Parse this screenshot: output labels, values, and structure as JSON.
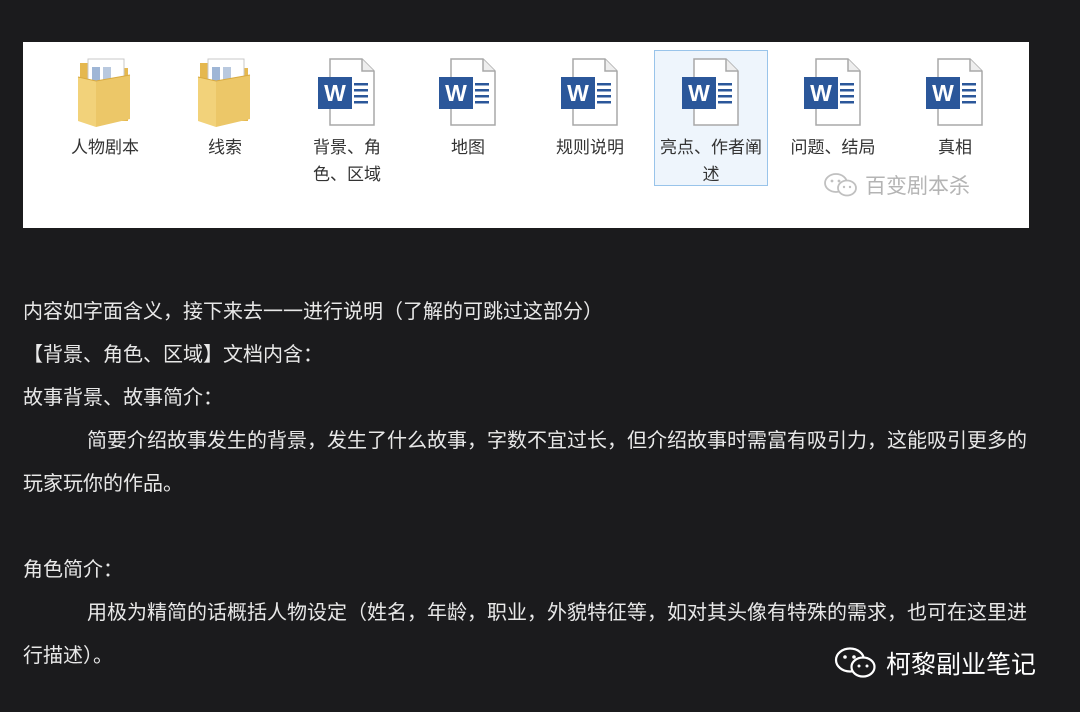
{
  "explorer": {
    "items": [
      {
        "label": "人物剧本",
        "icon": "folder-icon"
      },
      {
        "label": "线索",
        "icon": "folder-icon"
      },
      {
        "label": "背景、角色、区域",
        "icon": "word-document-icon"
      },
      {
        "label": "地图",
        "icon": "word-document-icon"
      },
      {
        "label": "规则说明",
        "icon": "word-document-icon"
      },
      {
        "label": "亮点、作者阐述",
        "icon": "word-document-icon",
        "selected": true
      },
      {
        "label": "问题、结局",
        "icon": "word-document-icon"
      },
      {
        "label": "真相",
        "icon": "word-document-icon"
      }
    ],
    "watermark": "百变剧本杀"
  },
  "article": {
    "p1": "内容如字面含义，接下来去一一进行说明（了解的可跳过这部分）",
    "p2": "【背景、角色、区域】文档内含：",
    "p3": "故事背景、故事简介：",
    "p4": "简要介绍故事发生的背景，发生了什么故事，字数不宜过长，但介绍故事时需富有吸引力，这能吸引更多的玩家玩你的作品。",
    "p5": "角色简介：",
    "p6": "用极为精简的话概括人物设定（姓名，年龄，职业，外貌特征等，如对其头像有特殊的需求，也可在这里进行描述）。"
  },
  "footer": {
    "watermark": "柯黎副业笔记"
  },
  "colors": {
    "background": "#1b1b1d",
    "word_blue": "#2b579a",
    "folder_yellow": "#e8c462",
    "selection_border": "#99c4ea",
    "selection_fill": "#eef5fc"
  }
}
